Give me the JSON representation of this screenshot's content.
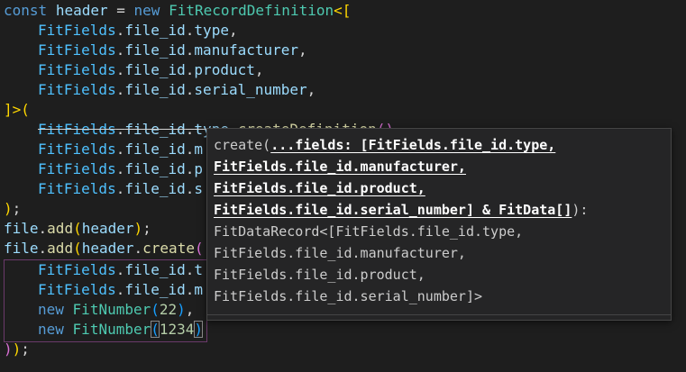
{
  "code": {
    "l1": {
      "kw": "const",
      "var": "header",
      "eq": "=",
      "kw2": "new",
      "cls": "FitRecordDefinition",
      "open": "<["
    },
    "l2": {
      "cn": "FitFields",
      "p1": ".",
      "prop1": "file_id",
      "p2": ".",
      "prop2": "type",
      "tail": ","
    },
    "l3": {
      "cn": "FitFields",
      "p1": ".",
      "prop1": "file_id",
      "p2": ".",
      "prop2": "manufacturer",
      "tail": ","
    },
    "l4": {
      "cn": "FitFields",
      "p1": ".",
      "prop1": "file_id",
      "p2": ".",
      "prop2": "product",
      "tail": ","
    },
    "l5": {
      "cn": "FitFields",
      "p1": ".",
      "prop1": "file_id",
      "p2": ".",
      "prop2": "serial_number",
      "tail": ","
    },
    "l6": {
      "close": "]>",
      "paren": "("
    },
    "l7": {
      "cn": "FitFields",
      "p1": ".",
      "prop1": "file_id",
      "p2": ".",
      "prop2": "type",
      "p3": ".",
      "fn": "createDefinition",
      "paren": "()"
    },
    "l8": {
      "cn": "FitFields",
      "p1": ".",
      "prop1": "file_id",
      "p2": ".",
      "prop2": "m"
    },
    "l9": {
      "cn": "FitFields",
      "p1": ".",
      "prop1": "file_id",
      "p2": ".",
      "prop2": "p"
    },
    "l10": {
      "cn": "FitFields",
      "p1": ".",
      "prop1": "file_id",
      "p2": ".",
      "prop2": "s"
    },
    "l11": {
      "paren": ")",
      "semi": ";"
    },
    "l12": {
      "var": "file",
      "dot": ".",
      "fn": "add",
      "open": "(",
      "arg": "header",
      "close": ")",
      "semi": ";"
    },
    "l13": {
      "var": "file",
      "dot": ".",
      "fn": "add",
      "open": "(",
      "arg": "header",
      "dot2": ".",
      "fn2": "create",
      "open2": "("
    },
    "l14": {
      "cn": "FitFields",
      "p1": ".",
      "prop1": "file_id",
      "p2": ".",
      "prop2": "t"
    },
    "l15": {
      "cn": "FitFields",
      "p1": ".",
      "prop1": "file_id",
      "p2": ".",
      "prop2": "m"
    },
    "l16": {
      "kw": "new",
      "cls": "FitNumber",
      "open": "(",
      "num": "22",
      "close": ")",
      "tail": ","
    },
    "l17": {
      "kw": "new",
      "cls": "FitNumber",
      "open": "(",
      "num": "1234",
      "close": ")"
    },
    "l18": {
      "close1": ")",
      "close2": ")",
      "semi": ";"
    }
  },
  "signature_help": {
    "line1_prefix": "create(",
    "line1_active": "...fields: [FitFields.file_id.type,",
    "line2_active": "FitFields.file_id.manufacturer,",
    "line3_active": "FitFields.file_id.product,",
    "line4_active": "FitFields.file_id.serial_number] & FitData[]",
    "line4_suffix": "):",
    "line5": "FitDataRecord<[FitFields.file_id.type,",
    "line6": "FitFields.file_id.manufacturer,",
    "line7": "FitFields.file_id.product,",
    "line8": "FitFields.file_id.serial_number]>"
  },
  "colors": {
    "background": "#1e1e1e",
    "popup_background": "#252526",
    "keyword": "#569cd6",
    "class": "#4ec9b0",
    "constant": "#4fc1ff",
    "property": "#9cdcfe",
    "function": "#dcdcaa",
    "number": "#b5cea8"
  }
}
